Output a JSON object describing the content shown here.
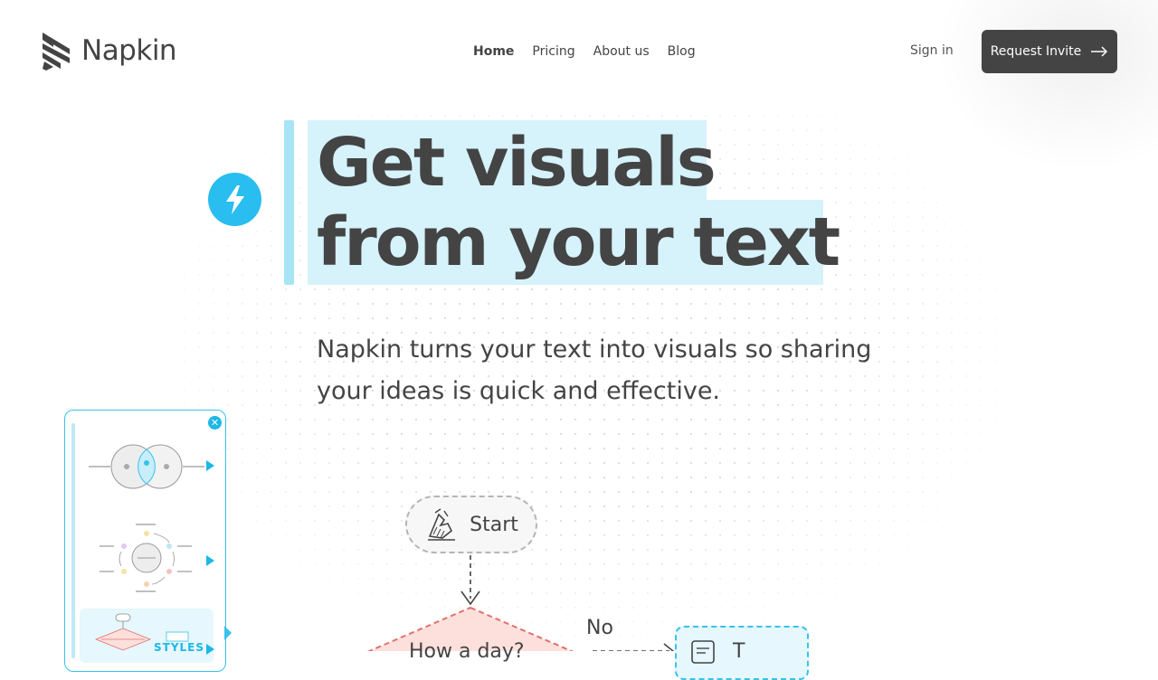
{
  "brand": {
    "name": "Napkin"
  },
  "nav": {
    "items": [
      {
        "label": "Home",
        "active": true
      },
      {
        "label": "Pricing",
        "active": false
      },
      {
        "label": "About us",
        "active": false
      },
      {
        "label": "Blog",
        "active": false
      }
    ]
  },
  "auth": {
    "sign_in_label": "Sign in",
    "request_invite_label": "Request Invite"
  },
  "hero": {
    "headline_line1": "Get visuals",
    "headline_line2": "from your text",
    "subtext": "Napkin turns your text into visuals so sharing your ideas is quick and effective.",
    "icon": "lightning-bolt-icon"
  },
  "styles_panel": {
    "label": "STYLES",
    "thumbnails": [
      "venn-diagram",
      "cycle-diagram",
      "flowchart"
    ]
  },
  "flowchart": {
    "start_label": "Start",
    "branch_label": "No",
    "decision_label": "How a day?",
    "right_node_label": "T"
  },
  "colors": {
    "accent": "#29bdf0",
    "highlight": "#d6f2fb",
    "text": "#444444",
    "button_bg": "#444444",
    "decision_fill": "#fde0dc",
    "decision_stroke": "#e2706a"
  }
}
